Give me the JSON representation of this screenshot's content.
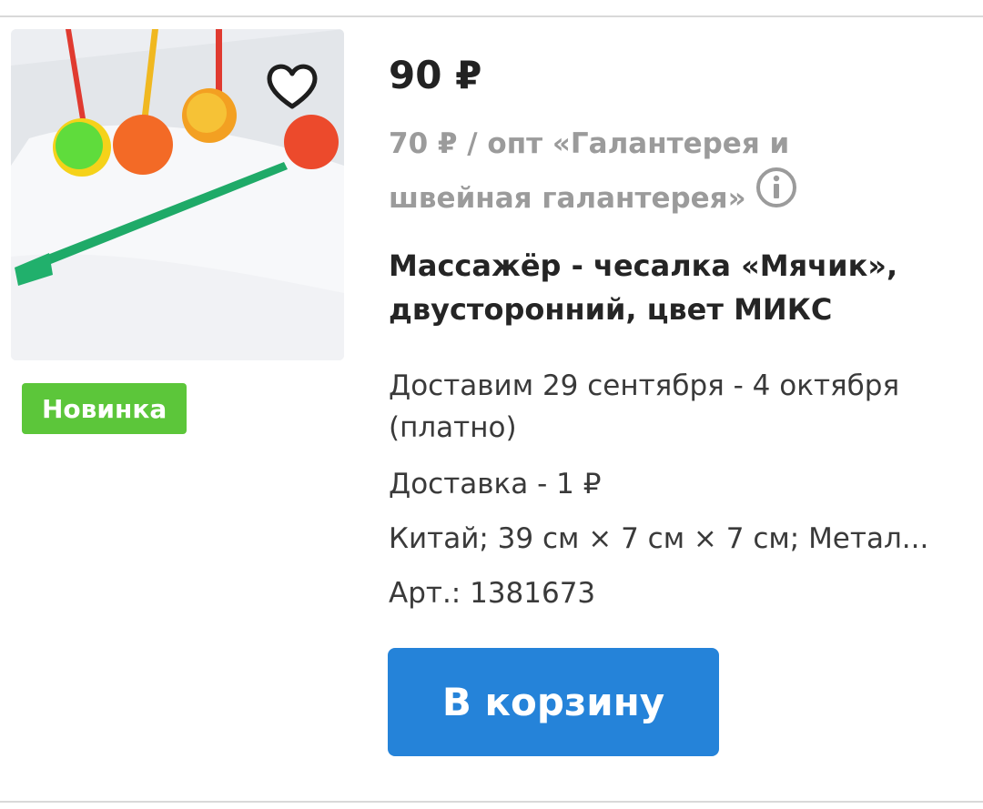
{
  "product": {
    "price": "90 ₽",
    "wholesale_text": "70 ₽ / опт «Галантерея и швейная галантерея»",
    "title": "Массажёр - чесалка «Мячик», двусторонний, цвет МИКС",
    "badge": "Новинка",
    "delivery": "Доставим 29 сентября - 4 октября (платно)",
    "shipping": "Доставка - 1 ₽",
    "specs": "Китай; 39 см × 7 см × 7 см; Метал...",
    "sku": "Арт.: 1381673",
    "cart_button": "В корзину"
  },
  "colors": {
    "accent": "#2583d9",
    "badge": "#5cc63a",
    "muted": "#9b9b9b"
  },
  "icons": {
    "favorite": "heart-outline-icon",
    "info": "info-circle-icon"
  }
}
